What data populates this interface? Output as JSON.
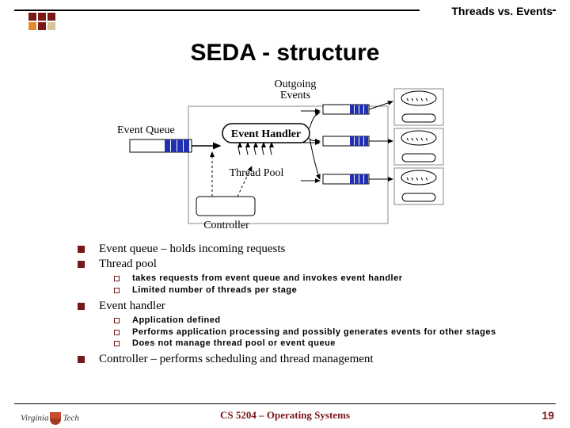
{
  "header": {
    "topic": "Threads vs. Events"
  },
  "title": "SEDA - structure",
  "diagram": {
    "event_queue_label": "Event Queue",
    "event_handler_label": "Event Handler",
    "outgoing_label": "Outgoing\nEvents",
    "thread_pool_label": "Thread Pool",
    "controller_label": "Controller"
  },
  "bullets": [
    {
      "level": 1,
      "text": "Event queue – holds incoming requests"
    },
    {
      "level": 1,
      "text": "Thread pool"
    },
    {
      "level": 2,
      "text": "takes requests from event queue and invokes event handler"
    },
    {
      "level": 2,
      "text": "Limited number of threads per stage"
    },
    {
      "level": 1,
      "text": "Event handler"
    },
    {
      "level": 2,
      "text": "Application defined"
    },
    {
      "level": 2,
      "text": "Performs application processing and possibly generates events for other stages"
    },
    {
      "level": 2,
      "text": "Does not manage thread pool or event queue"
    },
    {
      "level": 1,
      "text": "Controller – performs scheduling and thread management"
    }
  ],
  "footer": {
    "course": "CS 5204 – Operating Systems",
    "page": "19",
    "logo": {
      "left": "Virginia",
      "right": "Tech"
    }
  }
}
